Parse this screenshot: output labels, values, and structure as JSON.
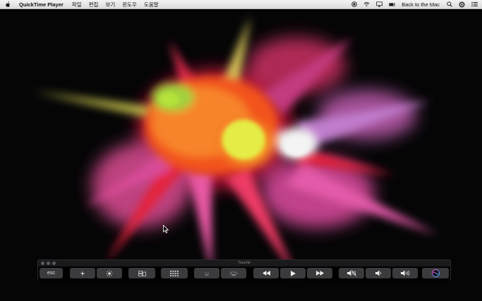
{
  "menubar": {
    "app_name": "QuickTime Player",
    "menus": [
      "파일",
      "편집",
      "보기",
      "윈도우",
      "도움말"
    ],
    "back_to_mac": "Back to the Mac"
  },
  "touchbar_window": {
    "title": "Touché"
  },
  "touchbar": {
    "esc_label": "esc"
  },
  "colors": {
    "menubar_bg": "#e6e6e6",
    "key_bg": "#3b3b3e",
    "bar_bg": "#000000"
  }
}
